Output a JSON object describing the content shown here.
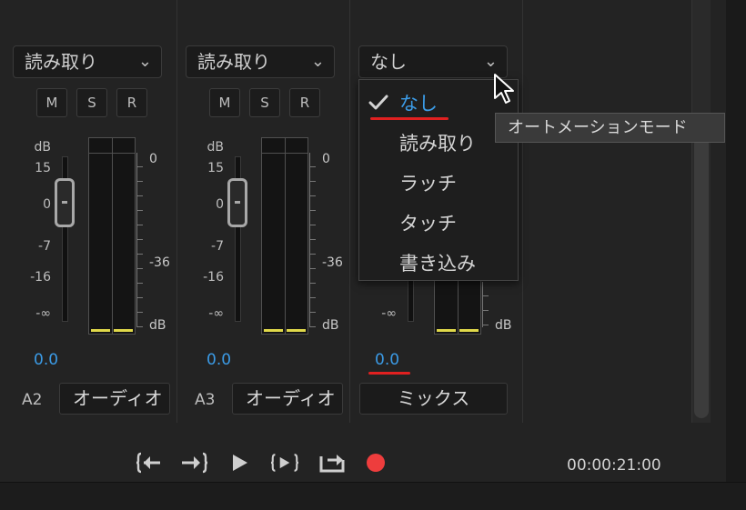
{
  "tracks": [
    {
      "id": "a2",
      "automation_mode": "読み取り",
      "buttons": [
        "M",
        "S",
        "R"
      ],
      "scale_left": [
        "dB",
        "15",
        "0",
        "-7",
        "-16",
        "-∞"
      ],
      "scale_right": [
        "0",
        "-36",
        "dB"
      ],
      "value": "0.0",
      "label": "A2",
      "name": "オーディオ"
    },
    {
      "id": "a3",
      "automation_mode": "読み取り",
      "buttons": [
        "M",
        "S",
        "R"
      ],
      "scale_left": [
        "dB",
        "15",
        "0",
        "-7",
        "-16",
        "-∞"
      ],
      "scale_right": [
        "0",
        "-36",
        "dB"
      ],
      "value": "0.0",
      "label": "A3",
      "name": "オーディオ"
    },
    {
      "id": "mix",
      "automation_mode": "なし",
      "scale_left": [
        "-∞"
      ],
      "scale_right": [
        "dB"
      ],
      "value": "0.0",
      "name": "ミックス"
    }
  ],
  "automation_menu": {
    "items": [
      "なし",
      "読み取り",
      "ラッチ",
      "タッチ",
      "書き込み"
    ],
    "selected": "なし"
  },
  "tooltip": "オートメーションモード",
  "transport": {
    "buttons": [
      "go-to-in-point",
      "go-to-out-point",
      "play",
      "play-in-to-out",
      "loop",
      "record"
    ],
    "timecode": "00:00:21:00"
  },
  "colors": {
    "accent_blue": "#3b9be6",
    "record_red": "#ee3d3d",
    "annotation_red": "#e02020",
    "meter_peak_yellow": "#e0d84a"
  }
}
